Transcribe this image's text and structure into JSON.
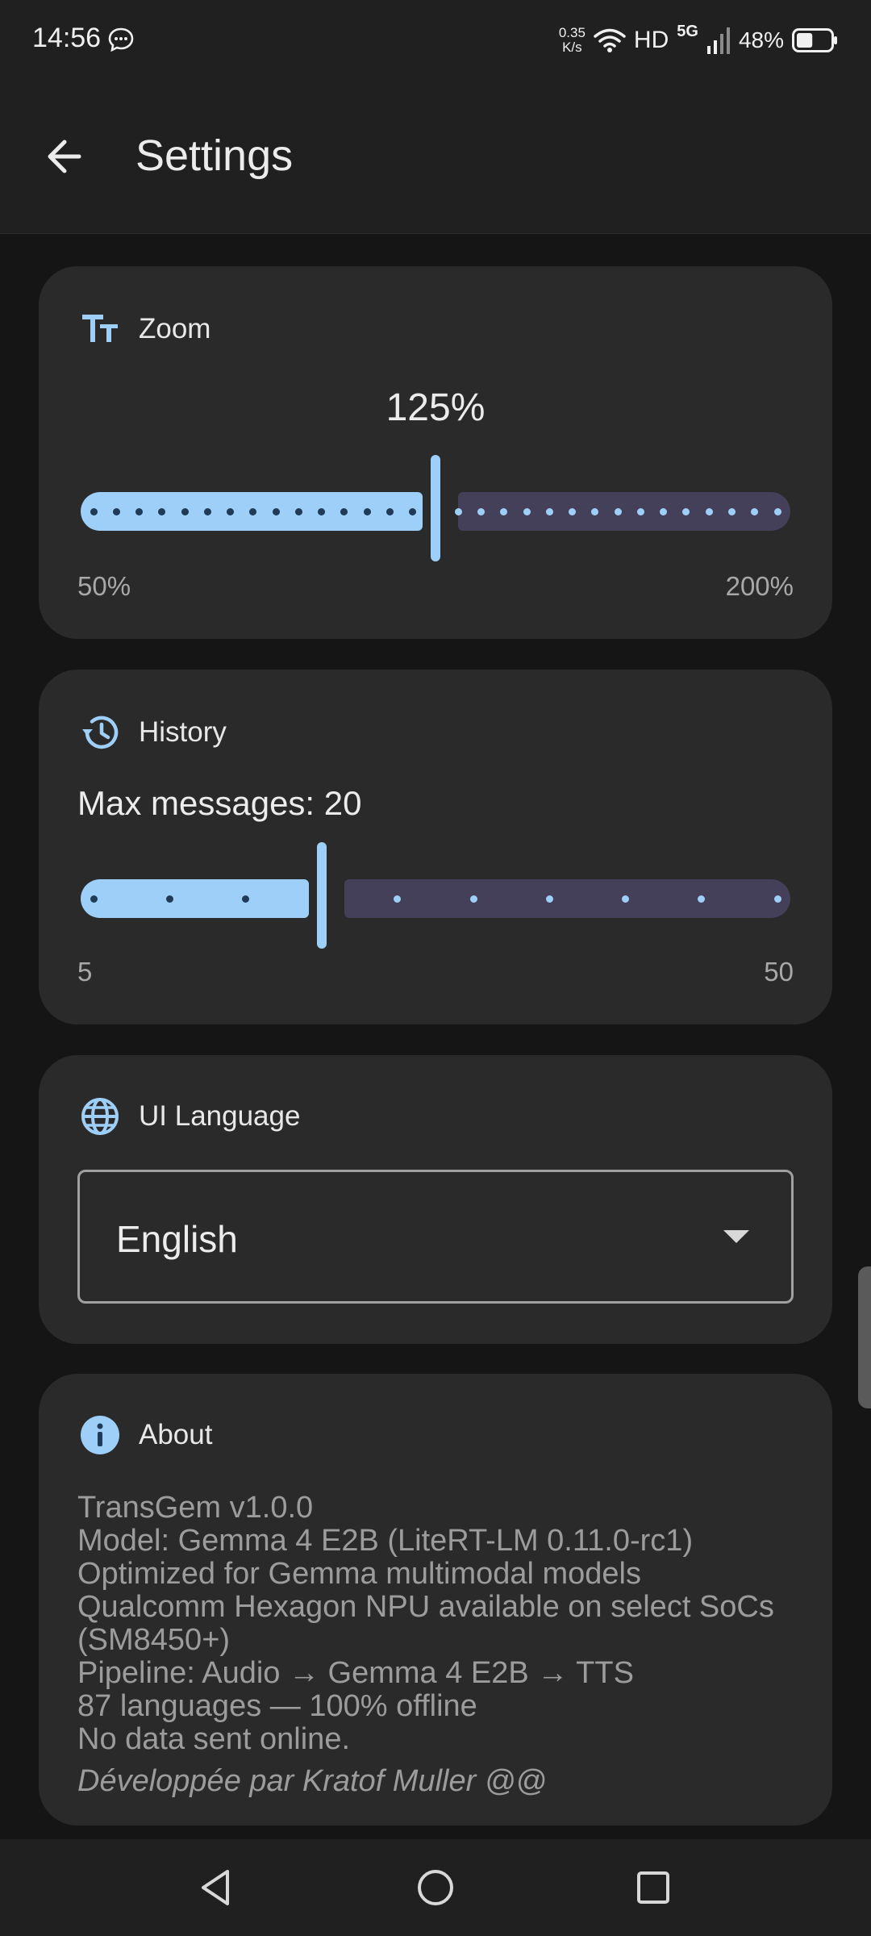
{
  "status_bar": {
    "time": "14:56",
    "net_speed_value": "0.35",
    "net_speed_unit": "K/s",
    "hd_label": "HD",
    "network_label": "5G",
    "battery_percent": "48%",
    "battery_level": 0.48
  },
  "app_bar": {
    "title": "Settings"
  },
  "zoom": {
    "title": "Zoom",
    "icon": "text-size-icon",
    "value_label": "125%",
    "value": 125,
    "min_label": "50%",
    "max_label": "200%",
    "min": 50,
    "max": 200,
    "step": 5
  },
  "history": {
    "title": "History",
    "icon": "history-icon",
    "max_messages_label": "Max messages: 20",
    "value": 20,
    "min_label": "5",
    "max_label": "50",
    "min": 5,
    "max": 50,
    "step": 5
  },
  "ui_language": {
    "title": "UI Language",
    "icon": "globe-icon",
    "selected": "English"
  },
  "about": {
    "title": "About",
    "icon": "info-icon",
    "lines": [
      "TransGem v1.0.0",
      "Model: Gemma 4 E2B (LiteRT-LM 0.11.0-rc1)",
      "Optimized for Gemma multimodal models",
      "Qualcomm Hexagon NPU available on select SoCs (SM8450+)",
      "Pipeline: Audio → Gemma 4 E2B → TTS",
      "87 languages — 100% offline",
      "No data sent online."
    ],
    "credit": "Développée par Kratof Muller @@"
  },
  "colors": {
    "accent": "#9ecff9",
    "inactive_track": "#45405a",
    "card": "#2a2a2a",
    "background": "#151515"
  }
}
